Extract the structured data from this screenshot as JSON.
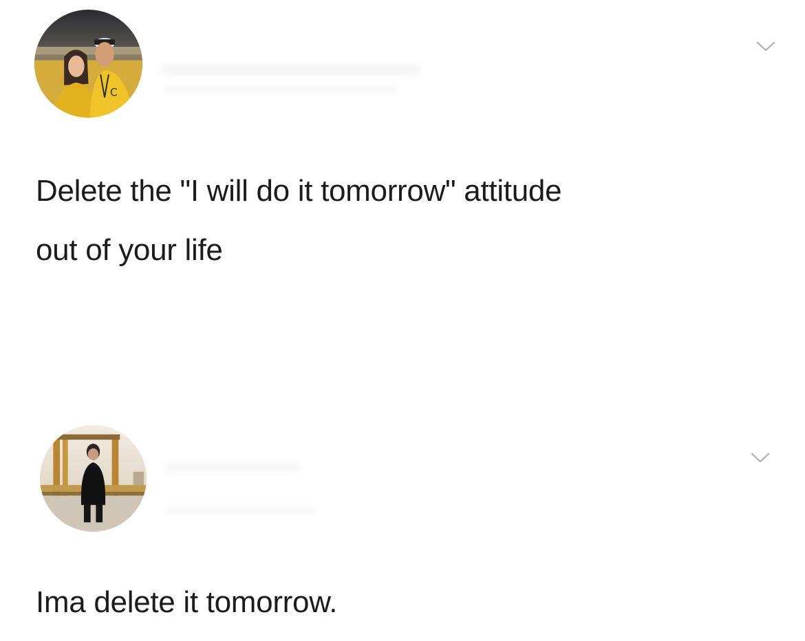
{
  "posts": [
    {
      "avatar_icon": "couple-at-stadium-photo",
      "text_lines": [
        "Delete the \"I will do it tomorrow\" attitude",
        "out of your life"
      ],
      "menu_icon": "chevron-down-icon"
    },
    {
      "avatar_icon": "person-seated-photo",
      "text_lines": [
        "Ima delete it tomorrow."
      ],
      "menu_icon": "chevron-down-icon"
    }
  ],
  "colors": {
    "background": "#ffffff",
    "text": "#1c1c1c",
    "chevron": "#b5b5b5"
  }
}
